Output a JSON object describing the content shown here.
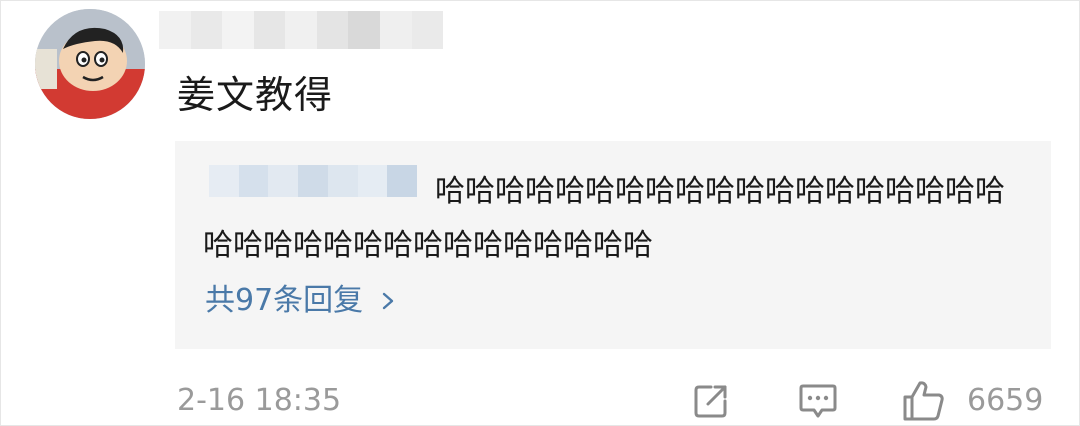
{
  "comment": {
    "text": "姜文教得",
    "timestamp": "2-16 18:35",
    "like_count": "6659"
  },
  "reply": {
    "text": "哈哈哈哈哈哈哈哈哈哈哈哈哈哈哈哈哈哈哈哈哈哈哈哈哈哈哈哈哈哈哈哈哈哈",
    "more_label": "共97条回复"
  },
  "icons": {
    "share": "share-icon",
    "comment": "comment-icon",
    "like": "thumbs-up-icon",
    "chevron": "chevron-right-icon"
  },
  "colors": {
    "link": "#4a79a8",
    "meta": "#9a9a9a",
    "reply_bg": "#f5f5f5"
  }
}
